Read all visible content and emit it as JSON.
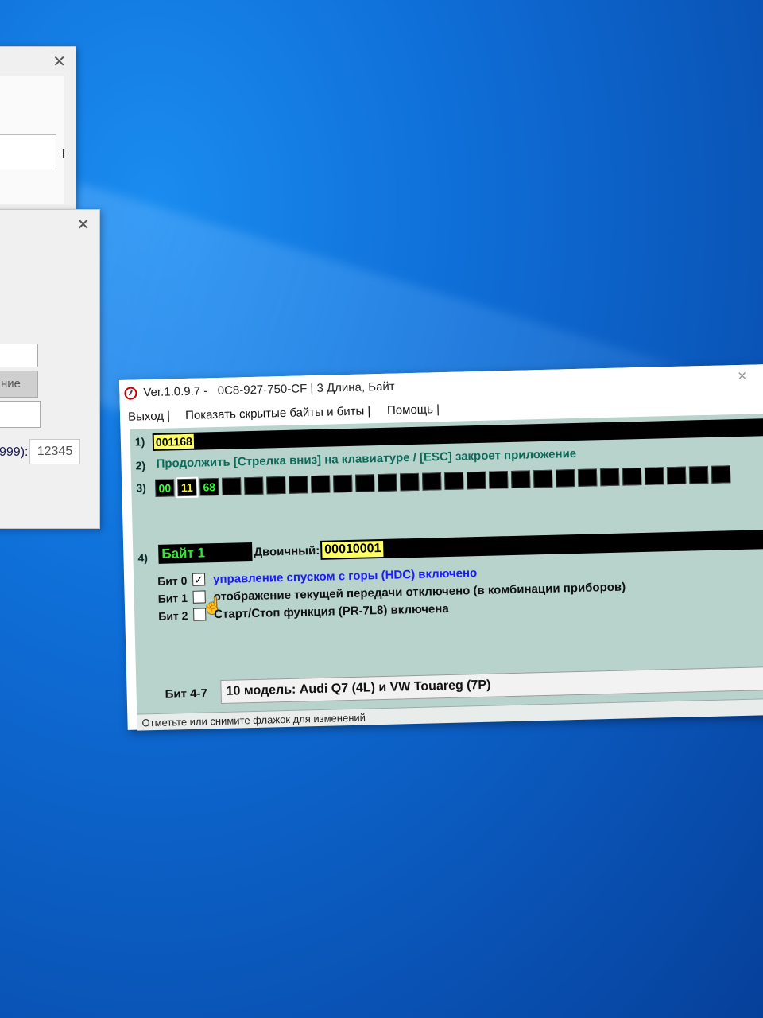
{
  "background_windows": {
    "win1": {
      "close": "✕"
    },
    "win2": {
      "close": "✕",
      "button_fragment": "ние",
      "label_fragment": "999):",
      "value": "12345"
    }
  },
  "window": {
    "title": "Ver.1.0.9.7 -   0C8-927-750-CF | 3 Длина, Байт",
    "close": "✕"
  },
  "menu": [
    "Выход |",
    "Показать скрытые байты и биты |",
    "Помощь |"
  ],
  "rows": {
    "r1": {
      "num": "1)",
      "address": "001168"
    },
    "r2": {
      "num": "2)",
      "hint": "Продолжить [Стрелка вниз] на клавиатуре / [ESC] закроет приложение"
    },
    "r3": {
      "num": "3)",
      "bytes": [
        "00",
        "11",
        "68"
      ],
      "selected_index": 1
    },
    "r4": {
      "num": "4)",
      "byte_label": "Байт 1",
      "binary_label": "Двоичный:",
      "binary_value": "00010001"
    }
  },
  "bits": [
    {
      "name": "Бит 0",
      "checked": true,
      "desc": "управление спуском с горы (HDC) включено",
      "highlight": true
    },
    {
      "name": "Бит 1",
      "checked": false,
      "desc": "отображение текущей передачи отключено (в комбинации приборов)",
      "highlight": false
    },
    {
      "name": "Бит 2",
      "checked": false,
      "desc": "Старт/Стоп функция (PR-7L8) включена",
      "highlight": false
    }
  ],
  "bits47": {
    "label": "Бит 4-7",
    "value": "10 модель: Audi Q7 (4L) и VW Touareg (7P)"
  },
  "status": {
    "text": "Отметьте или снимите флажок для изменений",
    "num": "3"
  },
  "icons": {
    "checkmark": "✓",
    "cursor": "cursor-pointer-icon"
  }
}
